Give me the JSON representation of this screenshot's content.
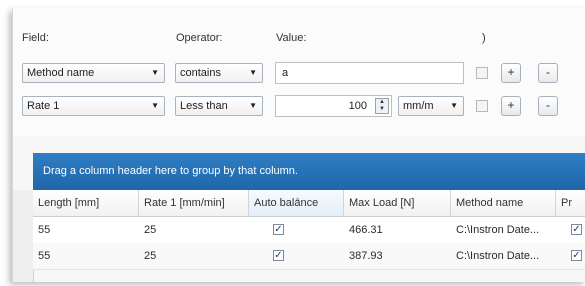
{
  "filter": {
    "field_label": "Field:",
    "operator_label": "Operator:",
    "value_label": "Value:",
    "paren_label": ")",
    "rows": [
      {
        "field": "Method name",
        "operator": "contains",
        "value": "a",
        "unit": ""
      },
      {
        "field": "Rate 1",
        "operator": "Less than",
        "value": "100",
        "unit": "mm/m"
      }
    ],
    "add_label": "+",
    "remove_label": "-",
    "dropdown_arrow": "▼",
    "spin_up": "▲",
    "spin_down": "▼"
  },
  "grid": {
    "group_hint": "Drag a column header here to group by that column.",
    "columns": [
      "Length [mm]",
      "Rate 1 [mm/min]",
      "Auto balance",
      "Max Load [N]",
      "Method name",
      "Pr"
    ],
    "sort_marker": "^",
    "rows": [
      {
        "length": "55",
        "rate": "25",
        "auto_balance": "✓",
        "max_load": "466.31",
        "method": "C:\\Instron Date...",
        "pr": "✓"
      },
      {
        "length": "55",
        "rate": "25",
        "auto_balance": "✓",
        "max_load": "387.93",
        "method": "C:\\Instron Date...",
        "pr": "✓"
      }
    ]
  },
  "colors": {
    "group_bar": "#2577bc",
    "accent": "#1f66aa"
  }
}
